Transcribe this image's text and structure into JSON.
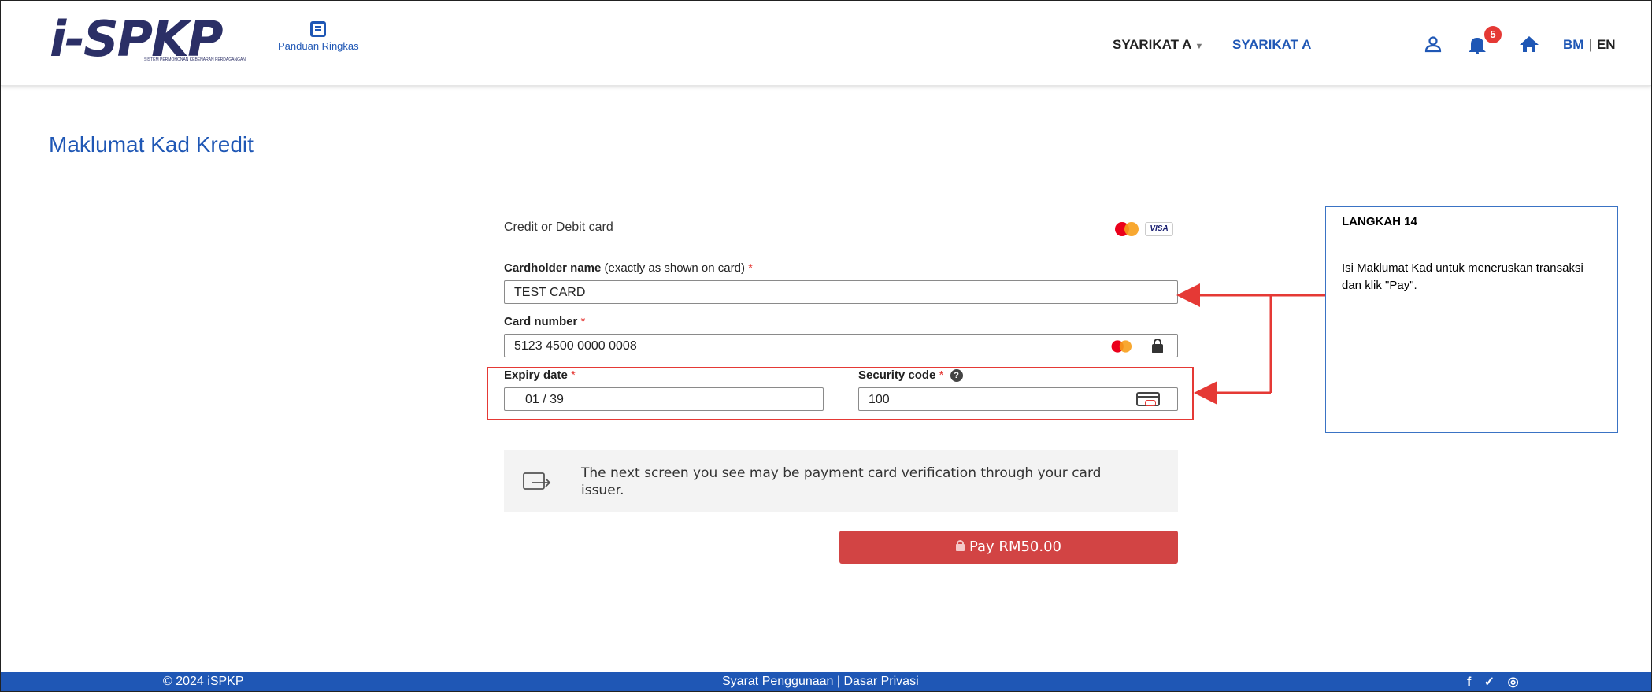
{
  "header": {
    "logo_text": "i-SPKP",
    "logo_subtitle": "SISTEM PERMOHONAN KEBENARAN PERDAGANGAN",
    "guide_label": "Panduan Ringkas",
    "company_dropdown": "SYARIKAT A",
    "company_name": "SYARIKAT A",
    "notification_count": "5",
    "lang_bm": "BM",
    "lang_sep": "|",
    "lang_en": "EN"
  },
  "page": {
    "title": "Maklumat Kad Kredit"
  },
  "form": {
    "card_type_title": "Credit or Debit card",
    "visa_label": "VISA",
    "cardholder_label": "Cardholder name",
    "cardholder_hint": "(exactly as shown on card)",
    "required_mark": "*",
    "cardholder_value": "TEST CARD",
    "card_number_label": "Card number",
    "card_number_value": "5123 4500 0000 0008",
    "expiry_label": "Expiry date",
    "expiry_value": "01  /  39",
    "security_label": "Security code",
    "help_mark": "?",
    "security_value": "100",
    "notice_text": "The next screen you see may be payment card verification through your card issuer.",
    "pay_label": "Pay RM50.00"
  },
  "instruction": {
    "title": "LANGKAH 14",
    "text": "Isi Maklumat Kad  untuk meneruskan transaksi dan klik  \"Pay\"."
  },
  "footer": {
    "copyright": "© 2024 iSPKP",
    "links": "Syarat Penggunaan | Dasar Privasi",
    "social": "f ✓ ◎"
  },
  "colors": {
    "brand_blue": "#1f57b5",
    "pay_red": "#d24444",
    "annotation_red": "#e53935"
  }
}
